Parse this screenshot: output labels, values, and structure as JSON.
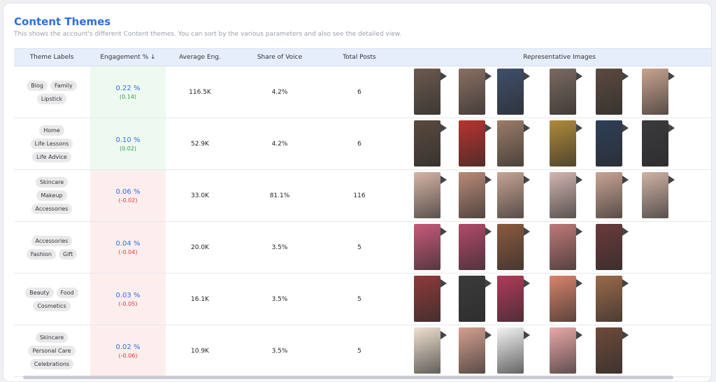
{
  "header": {
    "title": "Content Themes",
    "subtitle": "This shows the account's different Content themes. You can sort by the various parameters and also see the detailed view."
  },
  "columns": {
    "labels": "Theme Labels",
    "engagement": "Engagement % ↓",
    "avg": "Average Eng.",
    "sov": "Share of Voice",
    "posts": "Total Posts",
    "images": "Representative Images"
  },
  "rows": [
    {
      "tags": [
        [
          "Blog",
          "Family"
        ],
        [
          "Lipstick"
        ]
      ],
      "eng": "0.22 %",
      "chg": "(0.14)",
      "trend": "pos",
      "avg": "116.5K",
      "sov": "4.2%",
      "posts": "6"
    },
    {
      "tags": [
        [
          "Home"
        ],
        [
          "Life Lessons"
        ],
        [
          "Life Advice"
        ]
      ],
      "eng": "0.10 %",
      "chg": "(0.02)",
      "trend": "pos",
      "avg": "52.9K",
      "sov": "4.2%",
      "posts": "6"
    },
    {
      "tags": [
        [
          "Skincare"
        ],
        [
          "Makeup"
        ],
        [
          "Accessories"
        ]
      ],
      "eng": "0.06 %",
      "chg": "(-0.02)",
      "trend": "neg",
      "avg": "33.0K",
      "sov": "81.1%",
      "posts": "116"
    },
    {
      "tags": [
        [
          "Accessories"
        ],
        [
          "Fashion",
          "Gift"
        ]
      ],
      "eng": "0.04 %",
      "chg": "(-0.04)",
      "trend": "neg",
      "avg": "20.0K",
      "sov": "3.5%",
      "posts": "5"
    },
    {
      "tags": [
        [
          "Beauty",
          "Food"
        ],
        [
          "Cosmetics"
        ]
      ],
      "eng": "0.03 %",
      "chg": "(-0.05)",
      "trend": "neg",
      "avg": "16.1K",
      "sov": "3.5%",
      "posts": "5"
    },
    {
      "tags": [
        [
          "Skincare"
        ],
        [
          "Personal Care"
        ],
        [
          "Celebrations"
        ]
      ],
      "eng": "0.02 %",
      "chg": "(-0.06)",
      "trend": "neg",
      "avg": "10.9K",
      "sov": "3.5%",
      "posts": "5"
    }
  ],
  "images": [
    [
      "#6b5a4e",
      "#8a6f63",
      "#3e4f6b",
      "#7a6a60",
      "#5c4a3f",
      "#c9a48e"
    ],
    [
      "#5a4a3e",
      "#b8332f",
      "#9c7c68",
      "#b08a3a",
      "#2e3f58",
      "#3a3a3e"
    ],
    [
      "#d6b5a6",
      "#b98a78",
      "#c7a494",
      "#d2b6b0",
      "#c9a593",
      "#cfb3a6",
      "#3b4a5a"
    ],
    [
      "#c85a78",
      "#b24a6a",
      "#8c5a3e",
      "#c07a78",
      "#6b3a3a"
    ],
    [
      "#8e3a3a",
      "#3a3a3a",
      "#b03a5a",
      "#d9836b",
      "#9a6a4a"
    ],
    [
      "#efe1d0",
      "#d4a090",
      "#f4f4f4",
      "#eaa8a8",
      "#6e4a3a"
    ]
  ],
  "colors": {
    "accent": "#2f6fde",
    "positive": "#2e9a46",
    "negative": "#d9363e"
  }
}
